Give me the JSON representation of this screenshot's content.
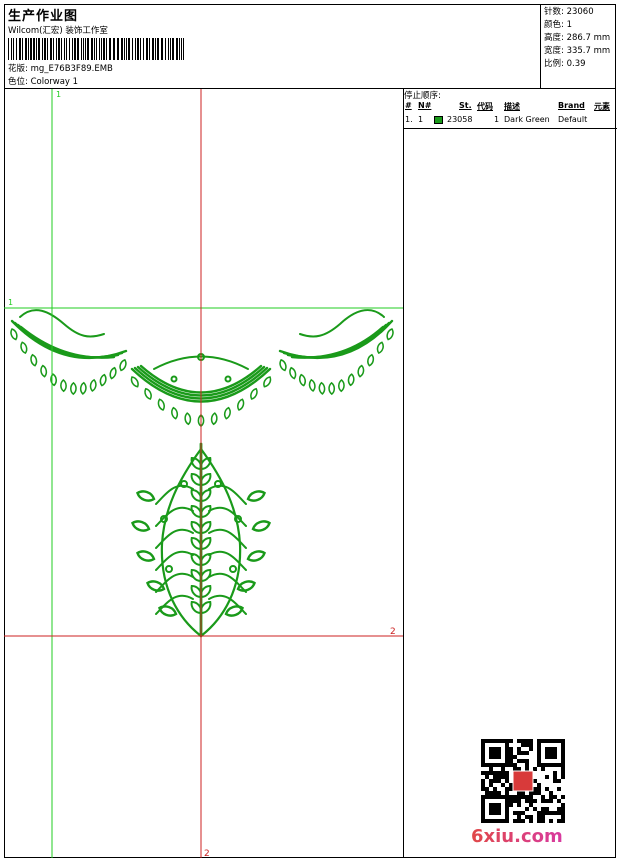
{
  "header": {
    "title": "生产作业图",
    "subtitle": "Wilcom(汇宏) 装饰工作室",
    "file_label": "花版:",
    "file_value": "mg_E76B3F89.EMB",
    "color_label": "色位:",
    "color_value": "Colorway 1"
  },
  "stats": [
    {
      "label": "针数:",
      "value": "23060"
    },
    {
      "label": "颜色:",
      "value": "1"
    },
    {
      "label": "高度:",
      "value": "286.7 mm"
    },
    {
      "label": "宽度:",
      "value": "335.7 mm"
    },
    {
      "label": "比例:",
      "value": "0.39"
    }
  ],
  "stop_sequence": {
    "title": "停止顺序:",
    "headers": [
      "#",
      "N#",
      "St.",
      "代码",
      "描述",
      "Brand",
      "元素"
    ],
    "rows": [
      {
        "num": "1.",
        "needle": "1",
        "color": "#1a9a1a",
        "stitches": "23058",
        "code": "1",
        "description": "Dark Green",
        "brand": "Default"
      }
    ]
  },
  "guides": {
    "green_vertical_label": "1",
    "green_horizontal_label": "1",
    "red_horizontal_label": "2",
    "red_vertical_label": "2",
    "green_color": "#22cc22",
    "red_color": "#cc2222"
  },
  "design": {
    "thread_color": "#1a9a1a"
  },
  "watermark": "6xiu.com"
}
